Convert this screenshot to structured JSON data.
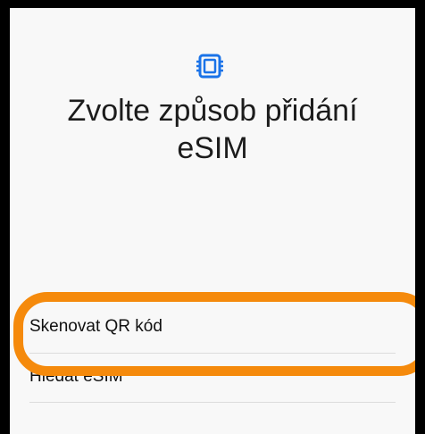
{
  "screen": {
    "title_line1": "Zvolte způsob přidání",
    "title_line2": "eSIM",
    "icon": "esim-card-icon",
    "accent_color": "#1a73e8"
  },
  "options": [
    {
      "label": "Skenovat QR kód"
    },
    {
      "label": "Hledat eSIM"
    }
  ],
  "annotation": {
    "highlight_color": "#f58a0c"
  }
}
